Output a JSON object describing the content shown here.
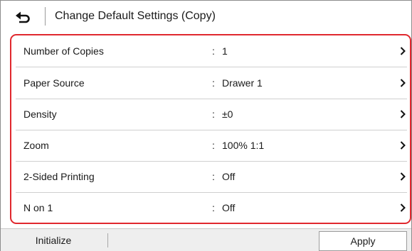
{
  "header": {
    "title": "Change Default Settings (Copy)",
    "back_icon": "return-arrow-icon"
  },
  "settings": {
    "items": [
      {
        "label": "Number of Copies",
        "value": "1"
      },
      {
        "label": "Paper Source",
        "value": "Drawer 1"
      },
      {
        "label": "Density",
        "value": "±0"
      },
      {
        "label": "Zoom",
        "value": "100% 1:1"
      },
      {
        "label": "2-Sided Printing",
        "value": "Off"
      },
      {
        "label": "N on 1",
        "value": "Off"
      }
    ],
    "separator": ":",
    "chevron_icon": "chevron-right-icon"
  },
  "footer": {
    "initialize_label": "Initialize",
    "apply_label": "Apply"
  },
  "colors": {
    "highlight_border": "#e0282e"
  }
}
